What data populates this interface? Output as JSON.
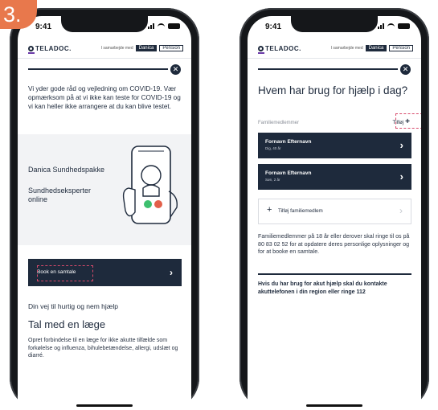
{
  "step_number": "3.",
  "status": {
    "time": "9:41"
  },
  "header": {
    "logo_text": "TELADOC.",
    "partner_text": "I samarbejde med",
    "partner_brand": "Danica",
    "partner_sub": "Pension"
  },
  "left_screen": {
    "intro": "Vi yder gode råd og vejledning om COVID-19. Vær opmærksom på at vi ikke kan teste for COVID-19 og vi kan heller ikke arrangere at du kan blive testet.",
    "package_title": "Danica Sundhedspakke",
    "package_subtitle": "Sundhedseksperter online",
    "book_button": "Book en samtale",
    "way_heading": "Din vej til hurtig og nem hjælp",
    "doctor_heading": "Tal med en læge",
    "doctor_text": "Opret forbindelse til en læge for ikke akutte tilfælde som forkølelse og influenza, bihulebetændelse, allergi, udslæt og diarré."
  },
  "right_screen": {
    "title": "Hvem har brug for hjælp i dag?",
    "section_label": "Familiemedlemmer",
    "add_link": "Tilføj",
    "members": [
      {
        "name": "Fornavn Efternavn",
        "detail": "Dig, 40 år"
      },
      {
        "name": "Fornavn Efternavn",
        "detail": "Søn, 2 år"
      }
    ],
    "add_member_label": "Tilføj familiemedlem",
    "info_text": "Familiemedlemmer på 18 år eller derover skal ringe til os på 80 83 02 52 for at opdatere deres personlige oplysninger og for at booke en samtale.",
    "emergency_text": "Hvis du har brug for akut hjælp skal du kontakte akuttelefonen i din region eller ringe 112"
  },
  "colors": {
    "navy": "#1e2a3c",
    "badge": "#e8784c",
    "highlight": "#d84a6b",
    "call_green": "#3dbf6e",
    "call_red": "#e2604a"
  }
}
